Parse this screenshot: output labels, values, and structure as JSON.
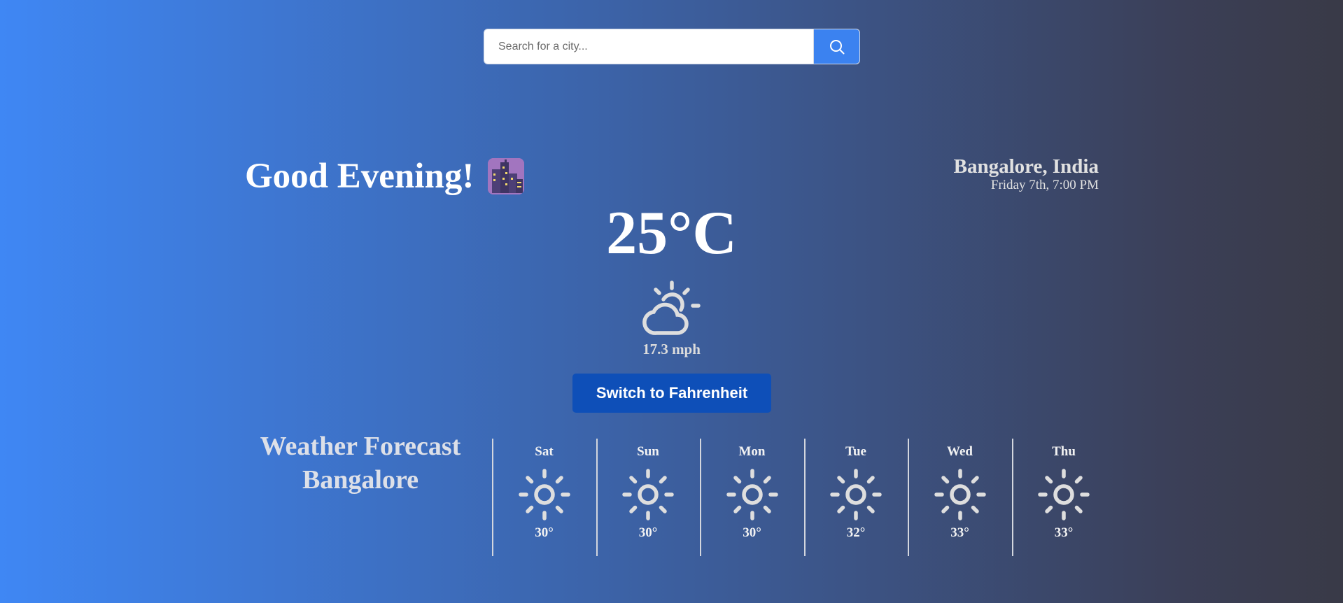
{
  "search": {
    "placeholder": "Search for a city...",
    "value": "",
    "button_icon": "search-icon",
    "button_color": "#3b82f0"
  },
  "greeting": {
    "text": "Good Evening!",
    "emoji": "night-city-emoji"
  },
  "location": {
    "city": "Bangalore, India",
    "datetime": "Friday 7th, 7:00 PM"
  },
  "current": {
    "temperature": "25°C",
    "condition_icon": "partly-cloudy-icon",
    "wind": "17.3 mph"
  },
  "unit_toggle": {
    "label": "Switch to Fahrenheit",
    "color": "#0e4fb8"
  },
  "forecast": {
    "title_line1": "Weather Forecast",
    "title_line2": "Bangalore",
    "days": [
      {
        "name": "Sat",
        "icon": "sun-icon",
        "temp": "30°"
      },
      {
        "name": "Sun",
        "icon": "sun-icon",
        "temp": "30°"
      },
      {
        "name": "Mon",
        "icon": "sun-icon",
        "temp": "30°"
      },
      {
        "name": "Tue",
        "icon": "sun-icon",
        "temp": "32°"
      },
      {
        "name": "Wed",
        "icon": "sun-icon",
        "temp": "33°"
      },
      {
        "name": "Thu",
        "icon": "sun-icon",
        "temp": "33°"
      }
    ]
  }
}
